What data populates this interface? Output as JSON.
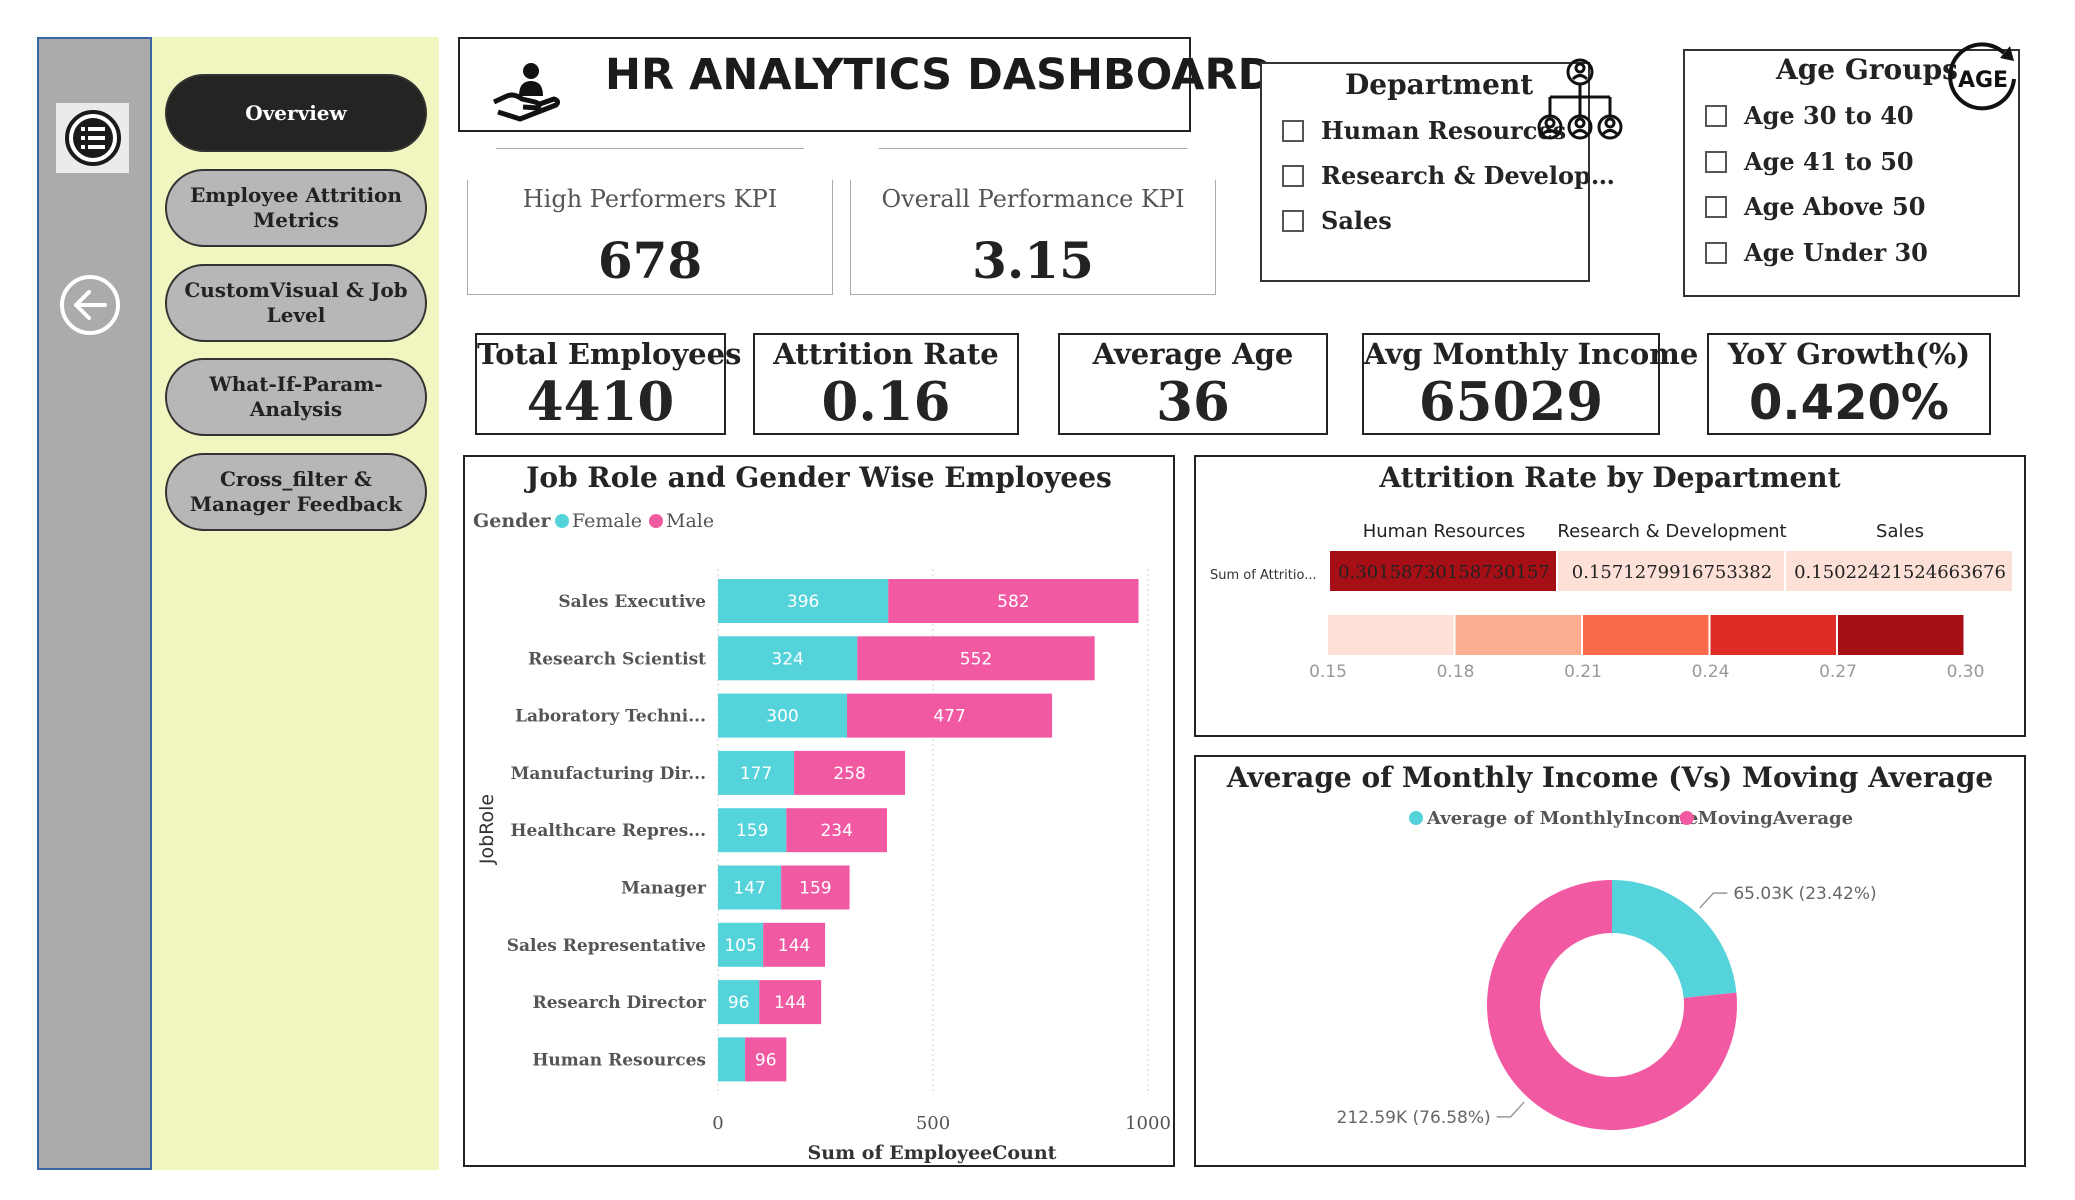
{
  "header": {
    "title": "HR ANALYTICS DASHBOARD"
  },
  "nav": {
    "items": [
      {
        "label": "Overview",
        "active": true
      },
      {
        "label": "Employee Attrition Metrics"
      },
      {
        "label": "CustomVisual & Job Level"
      },
      {
        "label": "What-If-Param-Analysis"
      },
      {
        "label": "Cross_filter & Manager Feedback"
      }
    ]
  },
  "kpis": {
    "high_performers": {
      "label": "High Performers KPI",
      "value": "678"
    },
    "overall_performance": {
      "label": "Overall Performance KPI",
      "value": "3.15"
    }
  },
  "slicers": {
    "department": {
      "title": "Department",
      "options": [
        "Human Resources",
        "Research & Develop…",
        "Sales"
      ]
    },
    "age_groups": {
      "title": "Age Groups",
      "badge": "AGE",
      "options": [
        "Age 30 to 40",
        "Age 41 to 50",
        "Age Above 50",
        "Age Under 30"
      ]
    }
  },
  "cards": {
    "total_employees": {
      "label": "Total Employees",
      "value": "4410"
    },
    "attrition_rate": {
      "label": "Attrition Rate",
      "value": "0.16"
    },
    "average_age": {
      "label": "Average Age",
      "value": "36"
    },
    "avg_monthly_income": {
      "label": "Avg Monthly Income",
      "value": "65029"
    },
    "yoy_growth": {
      "label": "YoY Growth(%)",
      "value": "0.420%"
    }
  },
  "colors": {
    "female": "#55d3da",
    "male": "#f15aa3",
    "heat": [
      "#fde1d8",
      "#fcae91",
      "#fb6a4a",
      "#de2d26",
      "#a50f15"
    ]
  },
  "chart_data": [
    {
      "type": "bar",
      "orientation": "horizontal",
      "stacked": true,
      "title": "Job Role and Gender Wise Employees",
      "legend_title": "Gender",
      "legend_position": "top-left",
      "xlabel": "Sum of EmployeeCount",
      "ylabel": "JobRole",
      "xlim": [
        0,
        1000
      ],
      "xticks": [
        "0",
        "500",
        "1000"
      ],
      "grid": true,
      "categories": [
        "Sales Executive",
        "Research Scientist",
        "Laboratory Techni...",
        "Manufacturing Dir...",
        "Healthcare Repres...",
        "Manager",
        "Sales Representative",
        "Research Director",
        "Human Resources"
      ],
      "series": [
        {
          "name": "Female",
          "values": [
            396,
            324,
            300,
            177,
            159,
            147,
            105,
            96,
            63
          ],
          "labels": [
            "396",
            "324",
            "300",
            "177",
            "159",
            "147",
            "105",
            "96",
            ""
          ]
        },
        {
          "name": "Male",
          "values": [
            582,
            552,
            477,
            258,
            234,
            159,
            144,
            144,
            96
          ],
          "labels": [
            "582",
            "552",
            "477",
            "258",
            "234",
            "159",
            "144",
            "144",
            "96"
          ]
        }
      ]
    },
    {
      "type": "heatmap",
      "title": "Attrition Rate by Department",
      "row_label": "Sum of Attritio...",
      "columns": [
        "Human Resources",
        "Research & Development",
        "Sales"
      ],
      "values": [
        0.30158730158730157,
        0.1571279916753382,
        0.15022421524663676
      ],
      "cell_labels": [
        "0.30158730158730157",
        "0.1571279916753382",
        "0.15022421524663676"
      ],
      "legend_ticks": [
        "0.15",
        "0.18",
        "0.21",
        "0.24",
        "0.27",
        "0.30"
      ]
    },
    {
      "type": "pie",
      "donut": true,
      "title": "Average of Monthly Income (Vs) Moving Average",
      "legend_position": "top",
      "labels": [
        "Average of MonthlyIncome",
        "MovingAverage"
      ],
      "values": [
        65.03,
        212.59
      ],
      "data_labels": [
        "65.03K (23.42%)",
        "212.59K (76.58%)"
      ]
    }
  ]
}
